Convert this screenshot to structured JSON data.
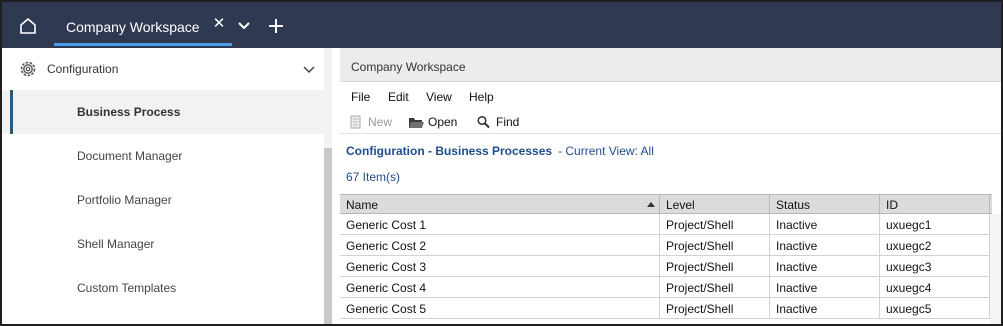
{
  "topbar": {
    "home_icon": "home-icon",
    "tab": {
      "label": "Company Workspace",
      "close_glyph": "✕"
    },
    "tab_menu_icon": "chevron-down-icon",
    "add_tab_icon": "plus-icon",
    "background_color": "#2f3a52"
  },
  "sidebar": {
    "header": {
      "label": "Configuration",
      "icon": "gear-icon",
      "toggle_icon": "chevron-down-icon"
    },
    "items": [
      {
        "label": "Business Process",
        "active": true
      },
      {
        "label": "Document Manager",
        "active": false
      },
      {
        "label": "Portfolio Manager",
        "active": false
      },
      {
        "label": "Shell Manager",
        "active": false
      },
      {
        "label": "Custom Templates",
        "active": false
      }
    ]
  },
  "main": {
    "title": "Company Workspace",
    "menu": [
      "File",
      "Edit",
      "View",
      "Help"
    ],
    "toolbar": {
      "new_label": "New",
      "open_label": "Open",
      "find_label": "Find"
    },
    "breadcrumb": {
      "link": "Configuration - Business Processes",
      "current_view": "- Current View:  All"
    },
    "count_text": "67  Item(s)",
    "grid": {
      "columns": [
        "Name",
        "Level",
        "Status",
        "ID"
      ],
      "sorted_column": "Name",
      "rows": [
        [
          "Generic Cost 1",
          "Project/Shell",
          "Inactive",
          "uxuegc1"
        ],
        [
          "Generic Cost 2",
          "Project/Shell",
          "Inactive",
          "uxuegc2"
        ],
        [
          "Generic Cost 3",
          "Project/Shell",
          "Inactive",
          "uxuegc3"
        ],
        [
          "Generic Cost 4",
          "Project/Shell",
          "Inactive",
          "uxuegc4"
        ],
        [
          "Generic Cost 5",
          "Project/Shell",
          "Inactive",
          "uxuegc5"
        ]
      ]
    }
  }
}
